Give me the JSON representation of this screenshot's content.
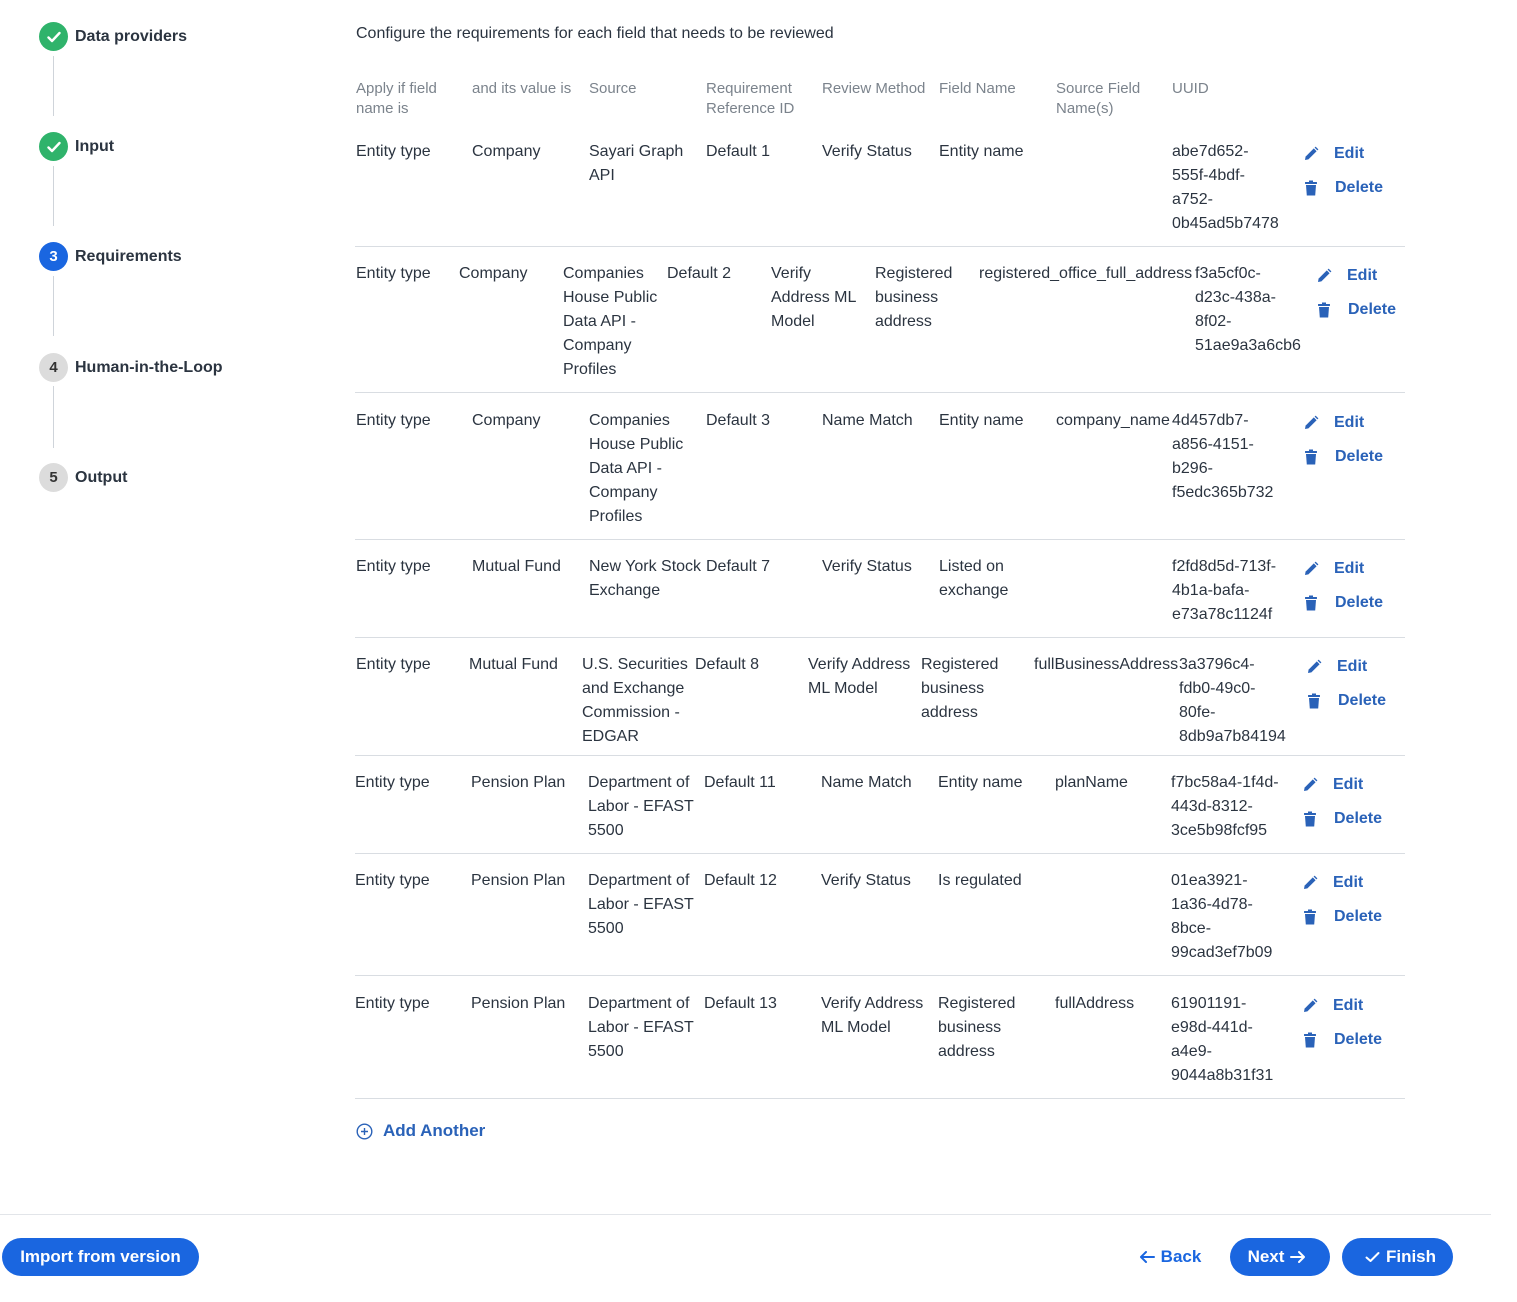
{
  "stepper": {
    "steps": [
      {
        "num": "",
        "label": "Data providers",
        "state": "done"
      },
      {
        "num": "",
        "label": "Input",
        "state": "done"
      },
      {
        "num": "3",
        "label": "Requirements",
        "state": "current"
      },
      {
        "num": "4",
        "label": "Human-in-the-Loop",
        "state": "todo"
      },
      {
        "num": "5",
        "label": "Output",
        "state": "todo"
      }
    ]
  },
  "intro": "Configure the requirements for each field that needs to be reviewed",
  "table": {
    "headers": {
      "field": "Apply if field\nname is",
      "value": "and its value is",
      "source": "Source",
      "ref": "Requirement\nReference ID",
      "method": "Review Method",
      "fname": "Field Name",
      "sfield": "Source Field\nName(s)",
      "uuid": "UUID"
    },
    "rows": [
      {
        "field": "Entity type",
        "value": "Company",
        "source": "Sayari Graph\nAPI",
        "ref": "Default 1",
        "method": "Verify Status",
        "fname": "Entity name",
        "sfield": "",
        "uuid": "abe7d652-\n555f-4bdf-\na752-\n0b45ad5b7478"
      },
      {
        "field": "Entity type",
        "value": "Company",
        "source": "Companies\nHouse Public\nData API -\nCompany\nProfiles",
        "ref": "Default 2",
        "method": "Verify\nAddress ML\nModel",
        "fname": "Registered\nbusiness\naddress",
        "sfield": "registered_office_full_address",
        "uuid": "f3a5cf0c-\nd23c-438a-\n8f02-\n51ae9a3a6cb6"
      },
      {
        "field": "Entity type",
        "value": "Company",
        "source": "Companies\nHouse Public\nData API -\nCompany\nProfiles",
        "ref": "Default 3",
        "method": "Name Match",
        "fname": "Entity name",
        "sfield": "company_name",
        "uuid": "4d457db7-\na856-4151-\nb296-\nf5edc365b732"
      },
      {
        "field": "Entity type",
        "value": "Mutual Fund",
        "source": "New York Stock\nExchange",
        "ref": "Default 7",
        "method": "Verify Status",
        "fname": "Listed on\nexchange",
        "sfield": "",
        "uuid": "f2fd8d5d-713f-\n4b1a-bafa-\ne73a78c1124f"
      },
      {
        "field": "Entity type",
        "value": "Mutual Fund",
        "source": "U.S. Securities\nand Exchange\nCommission -\nEDGAR",
        "ref": "Default 8",
        "method": "Verify Address\nML Model",
        "fname": "Registered\nbusiness\naddress",
        "sfield": "fullBusinessAddress",
        "uuid": "3a3796c4-\nfdb0-49c0-\n80fe-\n8db9a7b84194"
      },
      {
        "field": "Entity type",
        "value": "Pension Plan",
        "source": "Department of\nLabor - EFAST\n5500",
        "ref": "Default 11",
        "method": "Name Match",
        "fname": "Entity name",
        "sfield": "planName",
        "uuid": "f7bc58a4-1f4d-\n443d-8312-\n3ce5b98fcf95"
      },
      {
        "field": "Entity type",
        "value": "Pension Plan",
        "source": "Department of\nLabor - EFAST\n5500",
        "ref": "Default 12",
        "method": "Verify Status",
        "fname": "Is regulated",
        "sfield": "",
        "uuid": "01ea3921-\n1a36-4d78-\n8bce-\n99cad3ef7b09"
      },
      {
        "field": "Entity type",
        "value": "Pension Plan",
        "source": "Department of\nLabor - EFAST\n5500",
        "ref": "Default 13",
        "method": "Verify Address\nML Model",
        "fname": "Registered\nbusiness\naddress",
        "sfield": "fullAddress",
        "uuid": "61901191-\ne98d-441d-\na4e9-\n9044a8b31f31"
      }
    ],
    "edit_label": "Edit",
    "delete_label": "Delete"
  },
  "add_another": "Add Another",
  "footer": {
    "import_label": "Import from version",
    "back_label": "Back",
    "next_label": "Next",
    "finish_label": "Finish"
  },
  "colors": {
    "primary": "#1a66e0",
    "done": "#2fb36b",
    "link": "#2a62b8"
  },
  "icons": {
    "edit": "pencil-icon",
    "delete": "trash-icon",
    "add": "plus-circle-icon",
    "done": "check-icon",
    "back": "arrow-left-icon",
    "next": "arrow-right-icon"
  }
}
